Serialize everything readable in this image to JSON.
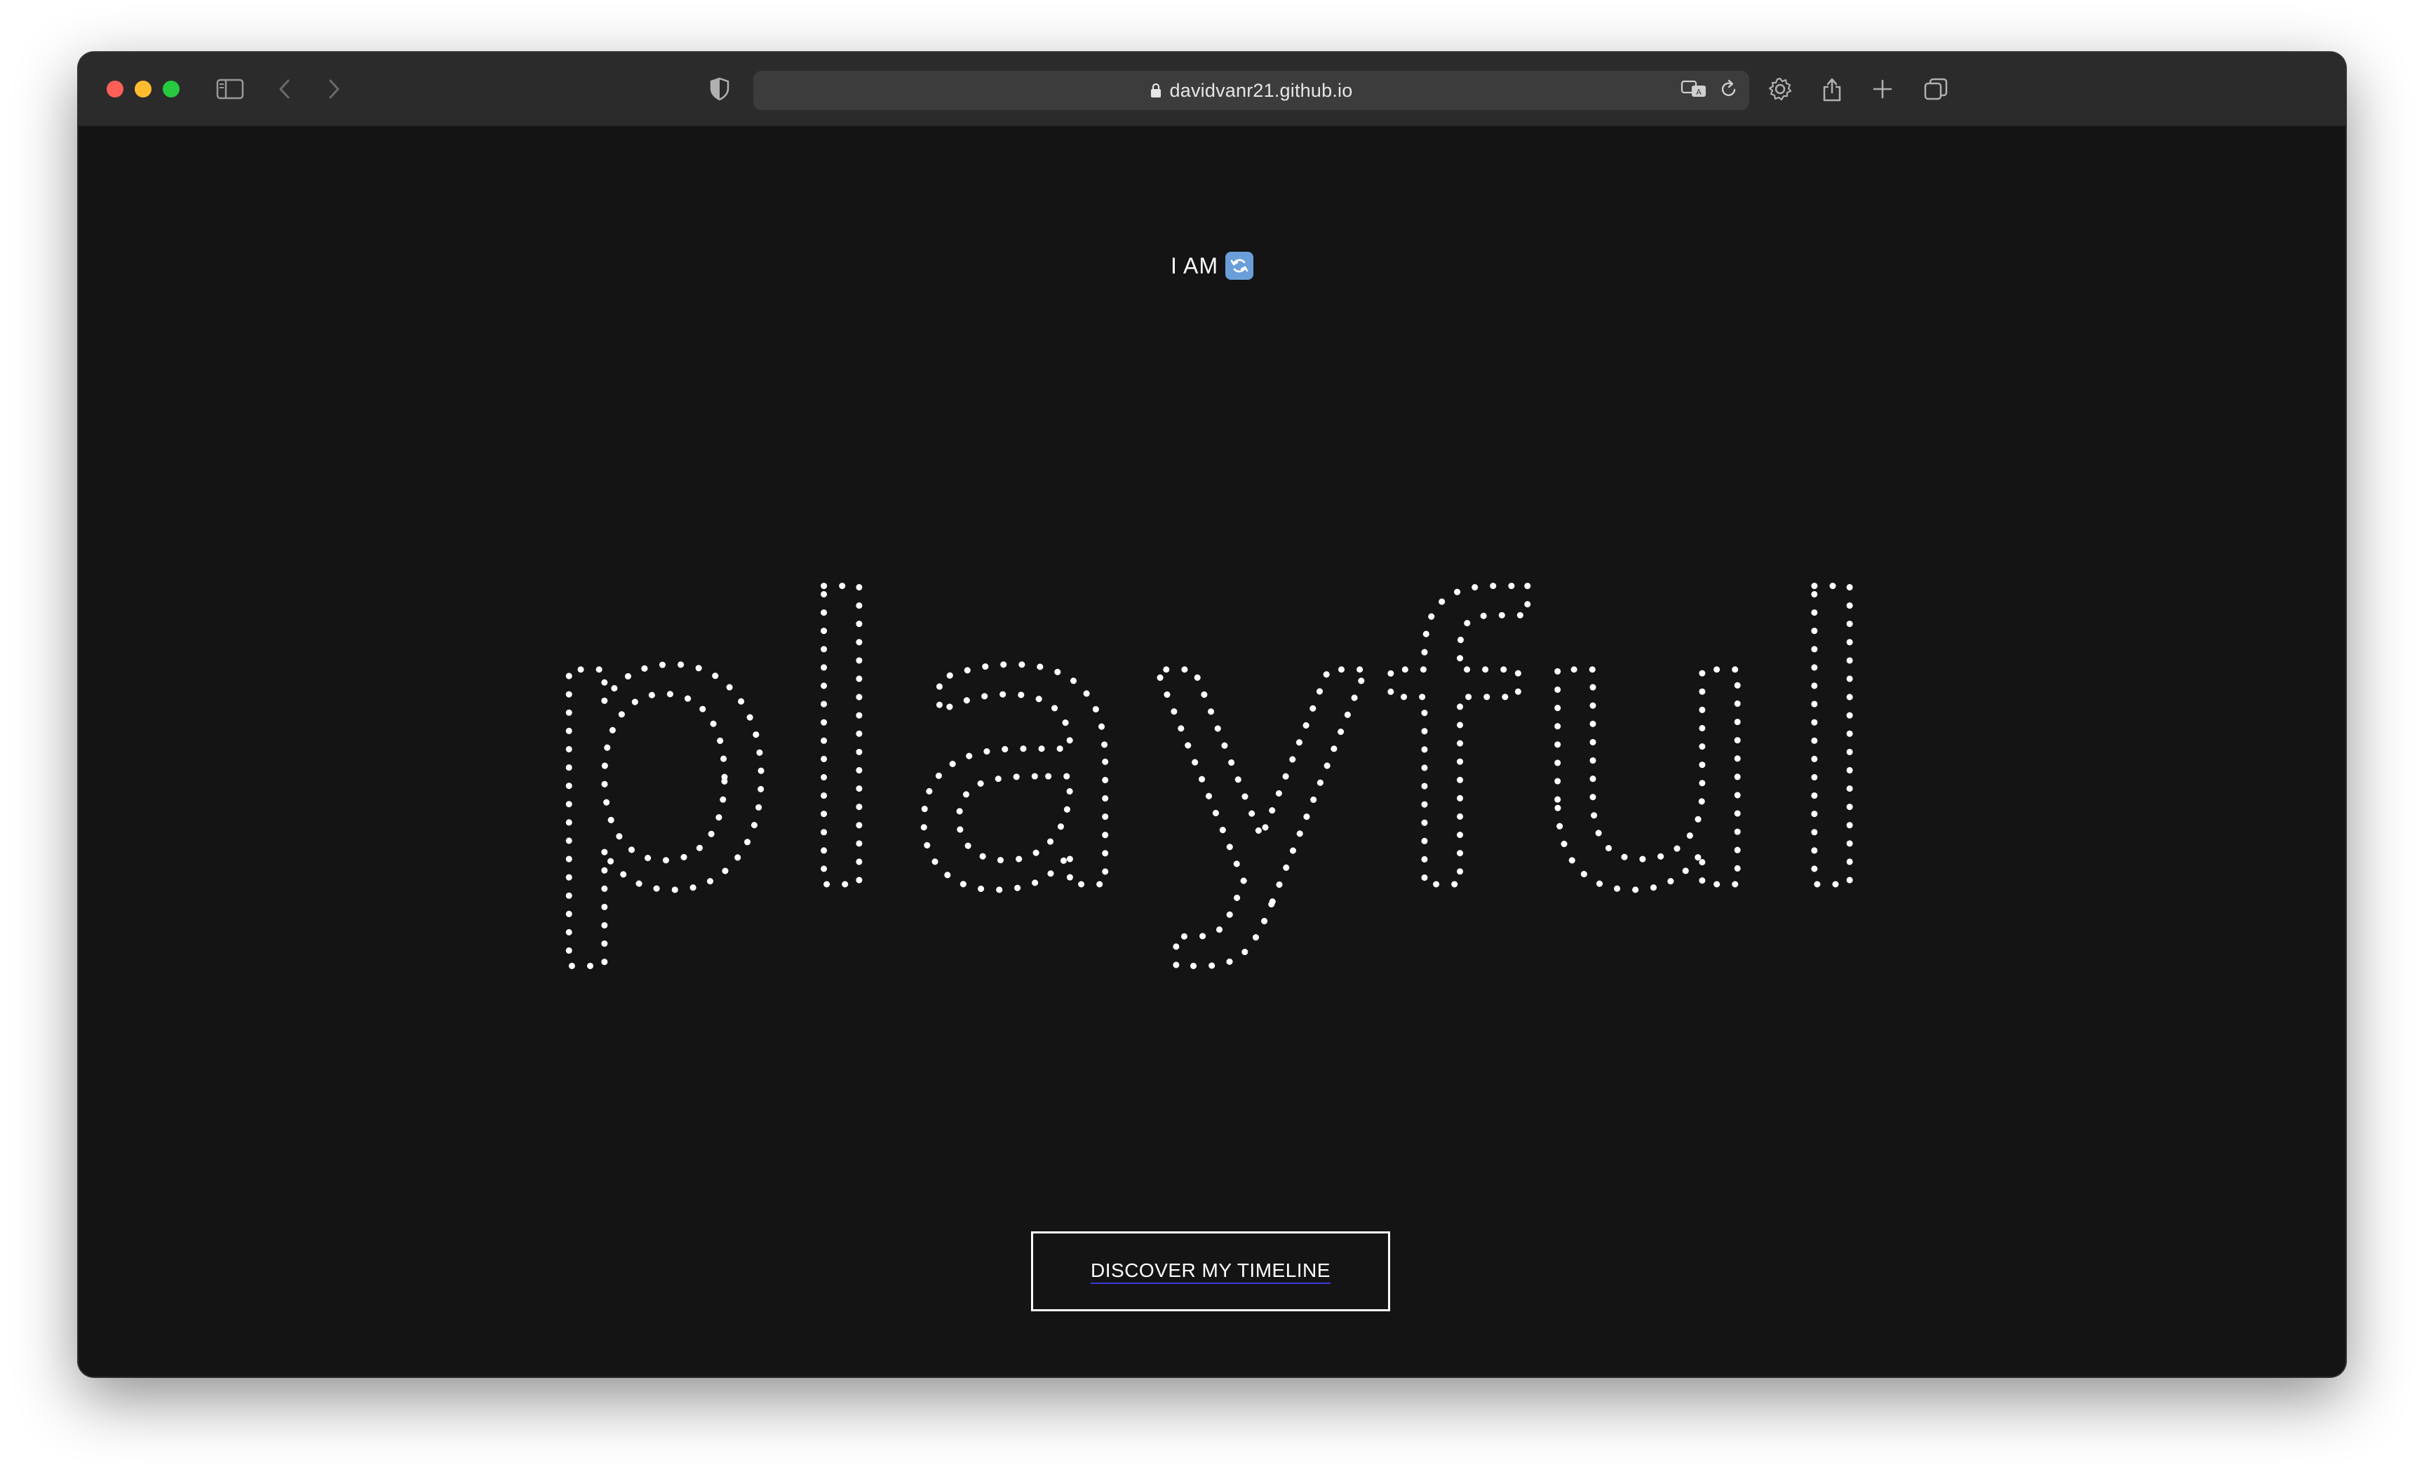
{
  "browser": {
    "url": "davidvanr21.github.io",
    "icons": [
      "sidebar-icon",
      "back-icon",
      "forward-icon",
      "shield-icon",
      "lock-icon",
      "translate-icon",
      "reload-icon",
      "gear-icon",
      "share-icon",
      "new-tab-icon",
      "tabs-overview-icon"
    ]
  },
  "hero": {
    "prefix": "I AM",
    "emoji_icon": "counterclockwise-arrows-icon",
    "word": "playful",
    "word_style": "dotted-outline",
    "dot_color": "#ffffff"
  },
  "cta": {
    "label": "DISCOVER MY TIMELINE"
  },
  "colors": {
    "background": "#141414",
    "toolbar": "#2b2b2b",
    "text": "#ffffff"
  }
}
